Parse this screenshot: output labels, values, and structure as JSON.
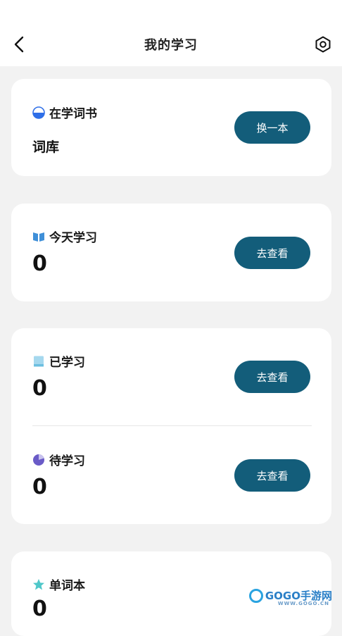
{
  "header": {
    "title": "我的学习",
    "back_icon": "chevron-left-icon",
    "settings_icon": "hexagon-gear-icon"
  },
  "current_book": {
    "label": "在学词书",
    "value": "词库",
    "button": "换一本",
    "icon": "half-circle-icon"
  },
  "today": {
    "label": "今天学习",
    "value": "0",
    "button": "去查看",
    "icon": "book-open-icon"
  },
  "learned": {
    "label": "已学习",
    "value": "0",
    "button": "去查看",
    "icon": "book-icon"
  },
  "to_learn": {
    "label": "待学习",
    "value": "0",
    "button": "去查看",
    "icon": "pie-icon"
  },
  "vocab": {
    "label": "单词本",
    "value": "0",
    "icon": "star-icon"
  },
  "watermark": {
    "text": "GOGO手游网",
    "sub": "WWW.GOGO.CN"
  },
  "colors": {
    "button": "#135d7a",
    "background": "#f2f2f2"
  }
}
